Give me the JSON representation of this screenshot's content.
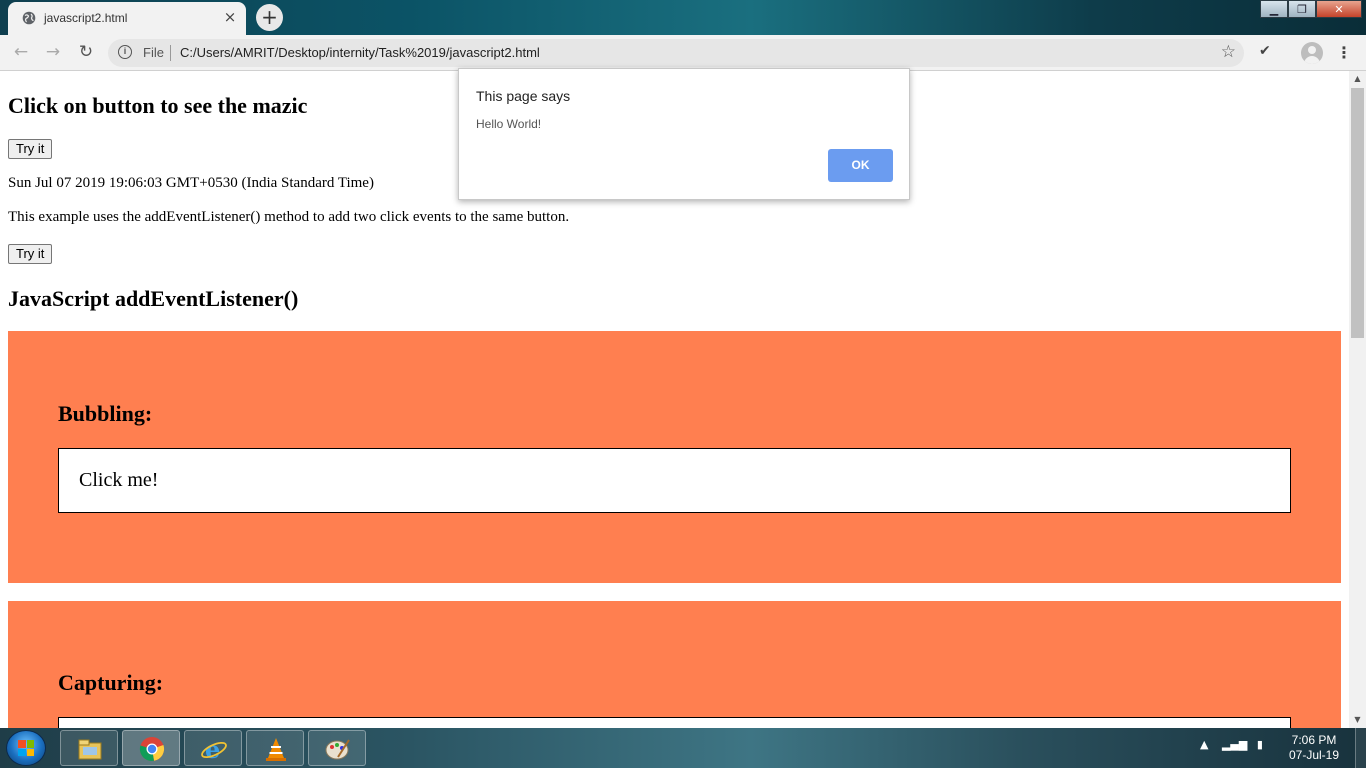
{
  "browser": {
    "tab_title": "javascript2.html",
    "tab_close": "×",
    "new_tab": "+",
    "window_controls": {
      "minimize": "▁",
      "maximize": "❐",
      "close": "✕"
    },
    "nav": {
      "back": "←",
      "forward": "→",
      "reload": "↻"
    },
    "omnibox": {
      "info": "i",
      "scheme_label": "File",
      "url": "C:/Users/AMRIT/Desktop/internity/Task%2019/javascript2.html",
      "star": "☆"
    },
    "extension_check": "✔",
    "menu": "⋮"
  },
  "page": {
    "heading1": "Click on button to see the mazic",
    "button1_label": "Try it",
    "date_text": "Sun Jul 07 2019 19:06:03 GMT+0530 (India Standard Time)",
    "description": "This example uses the addEventListener() method to add two click events to the same button.",
    "button2_label": "Try it",
    "heading2": "JavaScript addEventListener()",
    "bubbling": {
      "title": "Bubbling:",
      "inner_text": "Click me!"
    },
    "capturing": {
      "title": "Capturing:"
    },
    "box_color": "#ff7f50"
  },
  "dialog": {
    "title": "This page says",
    "message": "Hello World!",
    "ok_label": "OK"
  },
  "taskbar": {
    "apps": [
      "file-explorer-icon",
      "chrome-icon",
      "internet-explorer-icon",
      "vlc-icon",
      "paint-icon"
    ],
    "clock_time": "7:06 PM",
    "clock_date": "07-Jul-19"
  }
}
